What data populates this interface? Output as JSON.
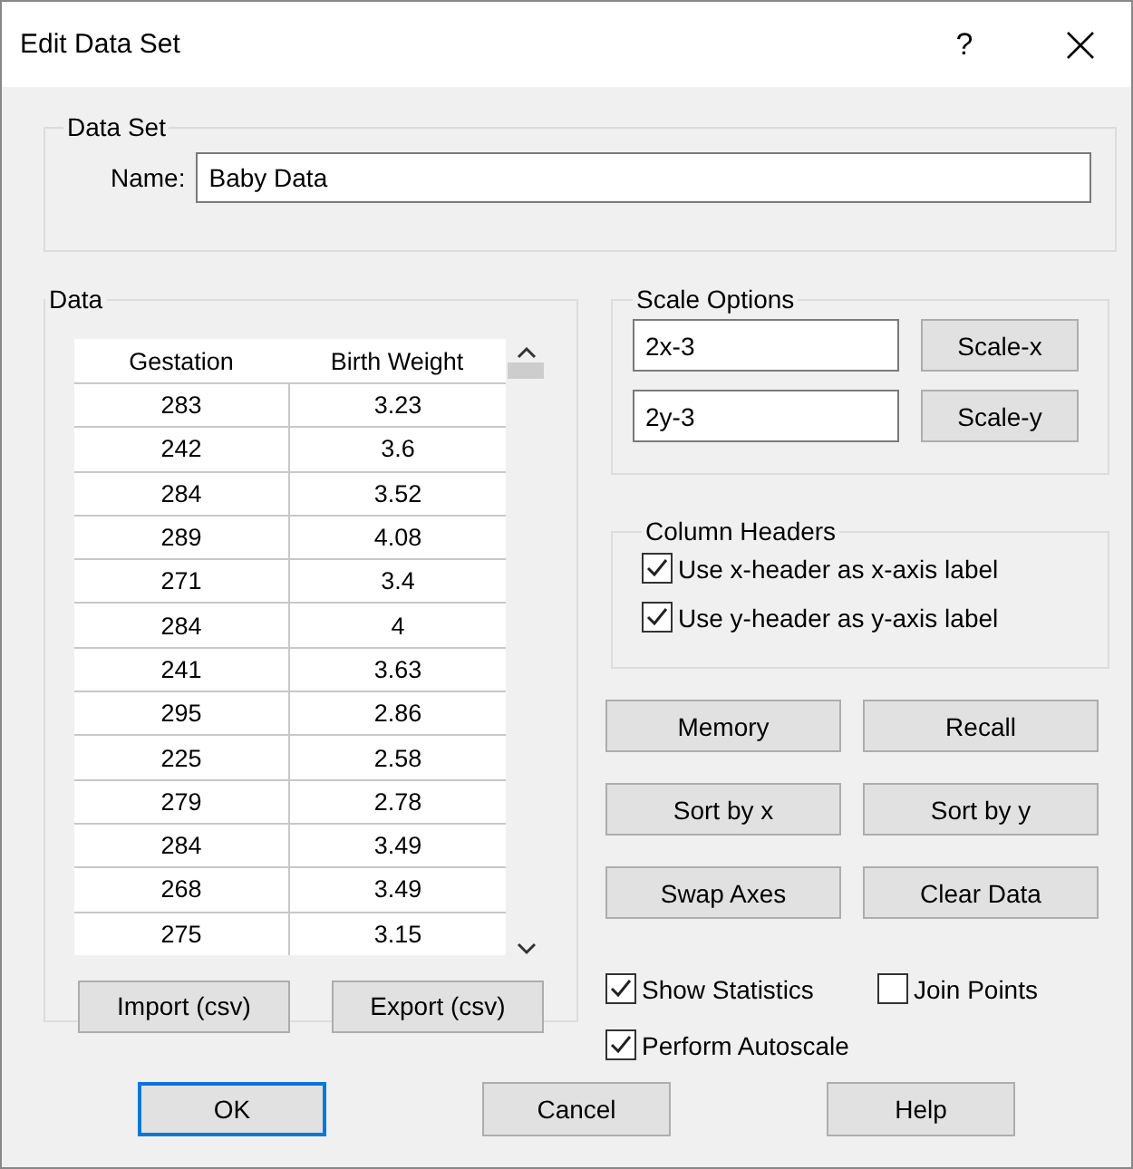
{
  "window": {
    "title": "Edit Data Set",
    "help": "?"
  },
  "data_set": {
    "title": "Data Set",
    "name_label": "Name:",
    "name_value": "Baby Data"
  },
  "data": {
    "title": "Data",
    "columns": [
      "Gestation",
      "Birth Weight"
    ],
    "rows": [
      [
        "283",
        "3.23"
      ],
      [
        "242",
        "3.6"
      ],
      [
        "284",
        "3.52"
      ],
      [
        "289",
        "4.08"
      ],
      [
        "271",
        "3.4"
      ],
      [
        "284",
        "4"
      ],
      [
        "241",
        "3.63"
      ],
      [
        "295",
        "2.86"
      ],
      [
        "225",
        "2.58"
      ],
      [
        "279",
        "2.78"
      ],
      [
        "284",
        "3.49"
      ],
      [
        "268",
        "3.49"
      ],
      [
        "275",
        "3.15"
      ]
    ],
    "buttons": [
      "Import (csv)",
      "Export (csv)"
    ]
  },
  "scale_options": {
    "title": "Scale Options",
    "rows": [
      {
        "value": "2x-3",
        "button": "Scale-x"
      },
      {
        "value": "2y-3",
        "button": "Scale-y"
      }
    ]
  },
  "column_headers": {
    "title": "Column Headers",
    "options": [
      {
        "label": "Use x-header as x-axis label",
        "checked": true
      },
      {
        "label": "Use y-header as y-axis label",
        "checked": true
      }
    ]
  },
  "actions": [
    [
      "Memory",
      "Recall"
    ],
    [
      "Sort by x",
      "Sort by y"
    ],
    [
      "Swap Axes",
      "Clear Data"
    ]
  ],
  "options": [
    {
      "label": "Show Statistics",
      "checked": true
    },
    {
      "label": "Join Points",
      "checked": false
    },
    {
      "label": "Perform Autoscale",
      "checked": true
    }
  ],
  "dialog_buttons": [
    {
      "label": "OK",
      "default": true
    },
    {
      "label": "Cancel",
      "default": false
    },
    {
      "label": "Help",
      "default": false
    }
  ]
}
